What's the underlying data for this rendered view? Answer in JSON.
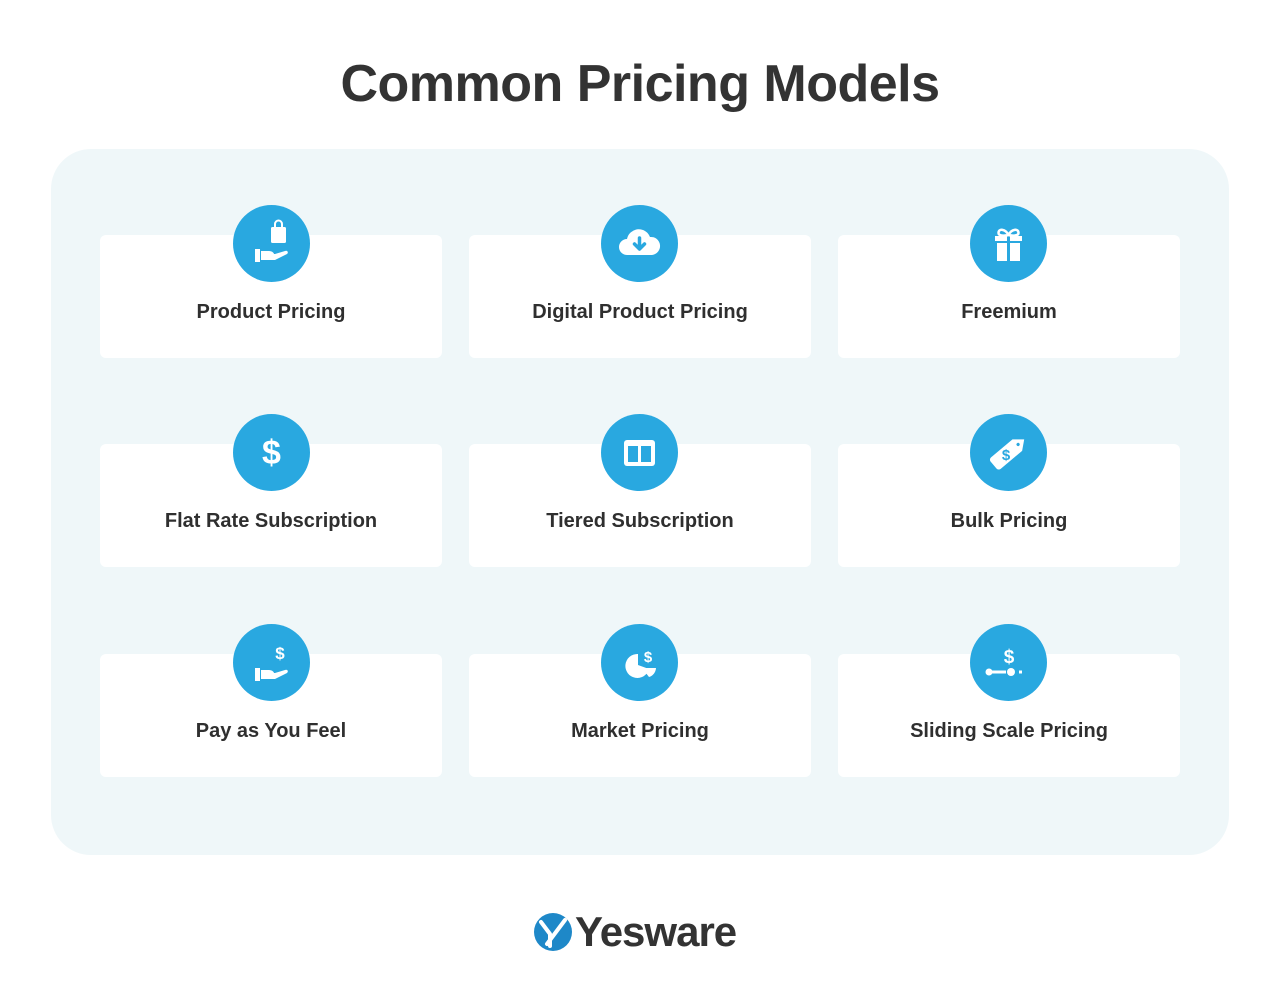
{
  "title": "Common Pricing Models",
  "colors": {
    "accent": "#29a8e0",
    "panel": "#eff7f9",
    "text": "#333333",
    "logo_blue": "#1e88c8"
  },
  "models": [
    {
      "label": "Product Pricing",
      "icon": "hand-with-shopping-bag-icon"
    },
    {
      "label": "Digital Product Pricing",
      "icon": "cloud-download-icon"
    },
    {
      "label": "Freemium",
      "icon": "gift-icon"
    },
    {
      "label": "Flat Rate Subscription",
      "icon": "dollar-sign-icon"
    },
    {
      "label": "Tiered Subscription",
      "icon": "columns-layout-icon"
    },
    {
      "label": "Bulk Pricing",
      "icon": "price-tag-icon"
    },
    {
      "label": "Pay as You Feel",
      "icon": "hand-with-dollar-icon"
    },
    {
      "label": "Market Pricing",
      "icon": "pie-chart-dollar-icon"
    },
    {
      "label": "Sliding Scale Pricing",
      "icon": "slider-dollar-icon"
    }
  ],
  "logo": {
    "text": "Yesware"
  }
}
